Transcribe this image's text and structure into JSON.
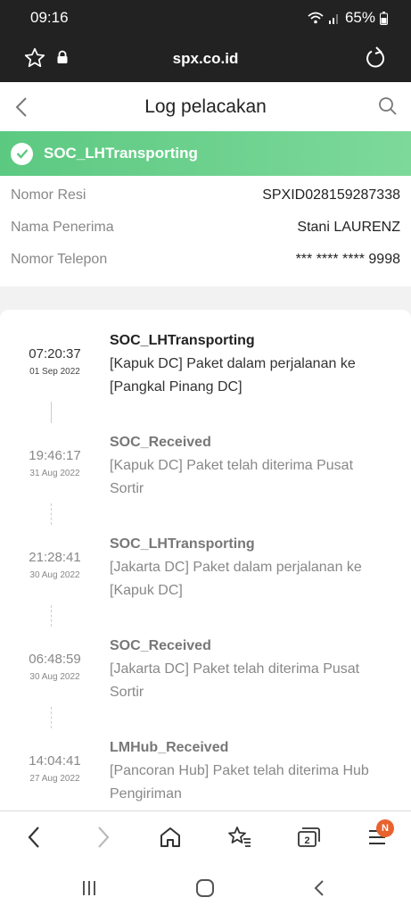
{
  "status_bar": {
    "time": "09:16",
    "battery": "65%"
  },
  "browser": {
    "url": "spx.co.id"
  },
  "header": {
    "title": "Log pelacakan"
  },
  "banner": {
    "status": "SOC_LHTransporting"
  },
  "info": [
    {
      "label": "Nomor Resi",
      "value": "SPXID028159287338"
    },
    {
      "label": "Nama Penerima",
      "value": "Stani LAURENZ"
    },
    {
      "label": "Nomor Telepon",
      "value": "*** **** **** 9998"
    }
  ],
  "timeline": [
    {
      "time": "07:20:37",
      "date": "01 Sep 2022",
      "title": "SOC_LHTransporting",
      "desc": "[Kapuk DC] Paket dalam perjalanan ke [Pangkal Pinang DC]"
    },
    {
      "time": "19:46:17",
      "date": "31 Aug 2022",
      "title": "SOC_Received",
      "desc": "[Kapuk DC] Paket telah diterima Pusat Sortir"
    },
    {
      "time": "21:28:41",
      "date": "30 Aug 2022",
      "title": "SOC_LHTransporting",
      "desc": "[Jakarta DC] Paket dalam perjalanan ke [Kapuk DC]"
    },
    {
      "time": "06:48:59",
      "date": "30 Aug 2022",
      "title": "SOC_Received",
      "desc": "[Jakarta DC] Paket telah diterima Pusat Sortir"
    },
    {
      "time": "14:04:41",
      "date": "27 Aug 2022",
      "title": "LMHub_Received",
      "desc": "[Pancoran Hub] Paket telah diterima Hub Pengiriman"
    }
  ],
  "bottom_nav": {
    "badge": "N"
  },
  "icons": [
    "star-icon",
    "lock-icon",
    "reload-icon",
    "back-icon",
    "search-icon",
    "check-icon",
    "home-icon",
    "bookmarks-icon",
    "tabs-icon",
    "menu-icon"
  ],
  "colors": {
    "banner": "#5cc981",
    "badge": "#e8622f"
  }
}
